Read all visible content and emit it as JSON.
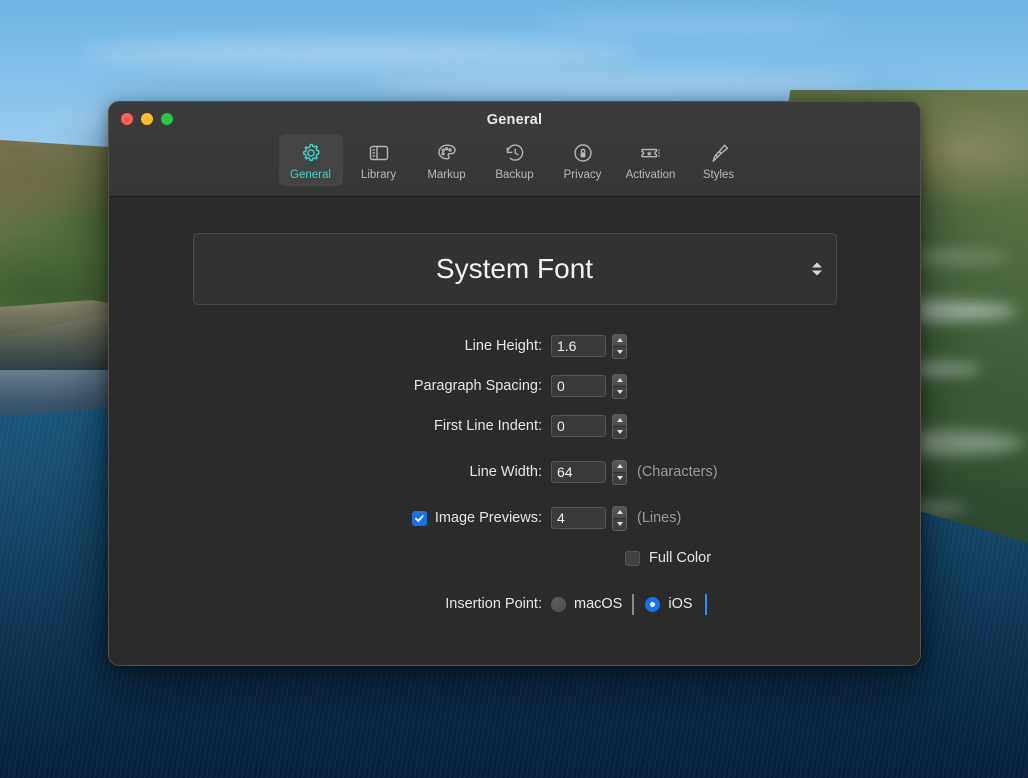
{
  "window": {
    "title": "General",
    "traffic_lights": [
      {
        "name": "close",
        "color": "#ff5f57"
      },
      {
        "name": "minimize",
        "color": "#febc2e"
      },
      {
        "name": "zoom",
        "color": "#28c840"
      }
    ]
  },
  "toolbar": {
    "selected": "General",
    "accent_color": "#3fd6cf",
    "items": [
      {
        "label": "General",
        "icon": "gear-icon",
        "selected": true
      },
      {
        "label": "Library",
        "icon": "sidebar-icon",
        "selected": false
      },
      {
        "label": "Markup",
        "icon": "palette-icon",
        "selected": false
      },
      {
        "label": "Backup",
        "icon": "clock-rewind-icon",
        "selected": false
      },
      {
        "label": "Privacy",
        "icon": "lock-circle-icon",
        "selected": false
      },
      {
        "label": "Activation",
        "icon": "ticket-star-icon",
        "selected": false
      },
      {
        "label": "Styles",
        "icon": "paintbrush-icon",
        "selected": false
      }
    ]
  },
  "font_selector": {
    "value": "System Font",
    "control": "popup-stepper"
  },
  "fields": {
    "line_height": {
      "label": "Line Height:",
      "value": "1.6"
    },
    "paragraph_spacing": {
      "label": "Paragraph Spacing:",
      "value": "0"
    },
    "first_line_indent": {
      "label": "First Line Indent:",
      "value": "0"
    },
    "line_width": {
      "label": "Line Width:",
      "value": "64",
      "unit": "(Characters)"
    },
    "image_previews": {
      "label": "Image Previews:",
      "value": "4",
      "unit": "(Lines)",
      "checked": true
    },
    "full_color": {
      "label": "Full Color",
      "checked": false
    }
  },
  "insertion_point": {
    "label": "Insertion Point:",
    "options": [
      {
        "label": "macOS",
        "selected": false,
        "caret_color": "#8a8a8a"
      },
      {
        "label": "iOS",
        "selected": true,
        "caret_color": "#2f8aee"
      }
    ],
    "selected_color": "#1573e6"
  }
}
